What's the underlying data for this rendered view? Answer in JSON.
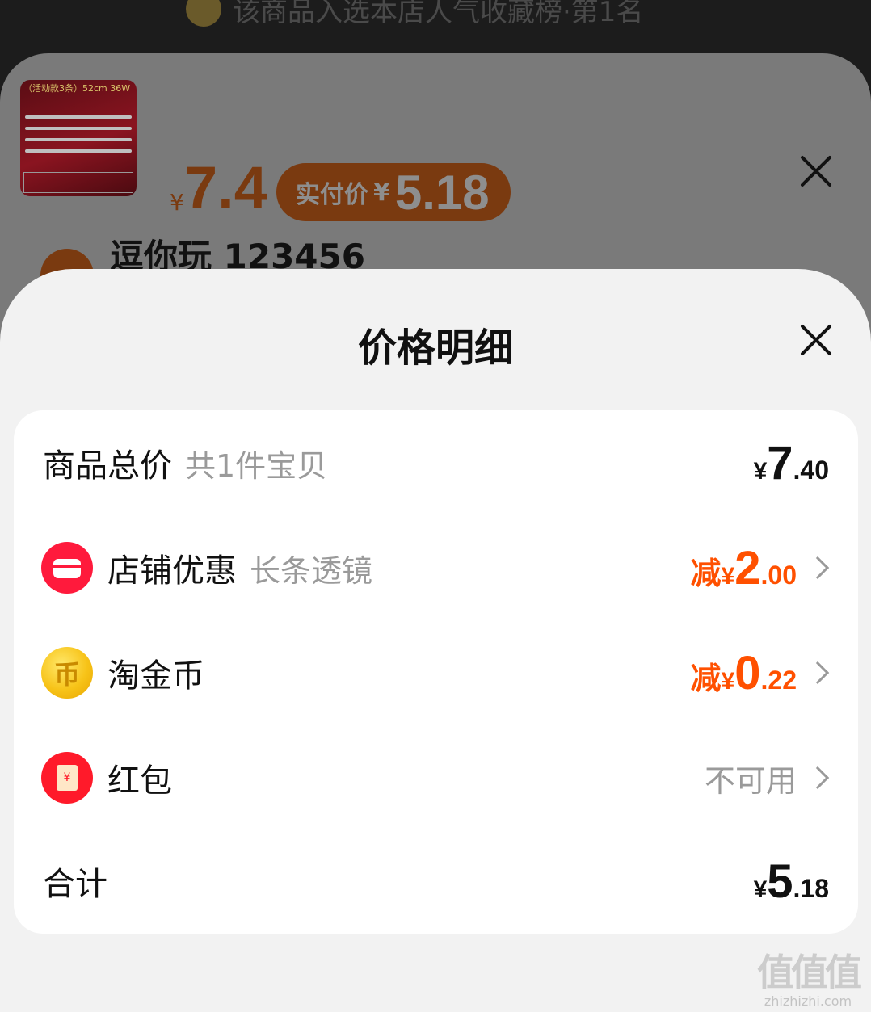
{
  "banner": {
    "text": "该商品入选本店人气收藏榜·第1名"
  },
  "sku": {
    "thumb_tag": "（活动款3条）52cm 36W",
    "price_currency": "¥",
    "price": "7.4",
    "pay_label": "实付价",
    "pay_currency": "¥",
    "pay_value": "5.18",
    "shop_name": "逗你玩 123456"
  },
  "sheet": {
    "title": "价格明细",
    "rows": {
      "total": {
        "label": "商品总价",
        "sub": "共1件宝贝",
        "currency": "¥",
        "int": "7",
        "dec": ".40"
      },
      "shop": {
        "label": "店铺优惠",
        "sub": "长条透镜",
        "prefix": "减",
        "currency": "¥",
        "int": "2",
        "dec": ".00",
        "icon": "shop-icon"
      },
      "coin": {
        "label": "淘金币",
        "prefix": "减",
        "currency": "¥",
        "int": "0",
        "dec": ".22",
        "icon": "coin-icon"
      },
      "redpack": {
        "label": "红包",
        "status": "不可用",
        "icon": "redpack-icon"
      },
      "sum": {
        "label": "合计",
        "currency": "¥",
        "int": "5",
        "dec": ".18"
      }
    }
  },
  "colors": {
    "accent": "#ff5000",
    "muted": "#9a9a9a"
  },
  "watermark": {
    "big": "值值值",
    "small": "zhizhizhi.com"
  }
}
